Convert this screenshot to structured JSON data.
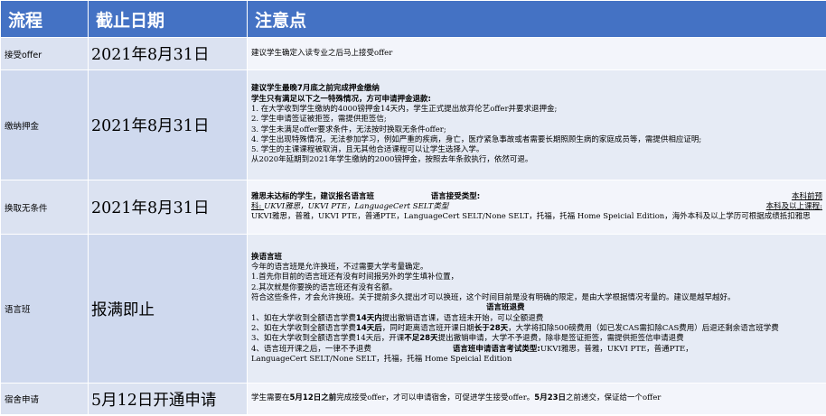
{
  "header": {
    "col1": "流程",
    "col2": "截止日期",
    "col3": "注意点"
  },
  "rows": [
    {
      "step": "接受offer",
      "deadline": "2021年8月31日",
      "notes": {
        "l1": "建议学生确定入读专业之后马上接受offer"
      }
    },
    {
      "step": "缴纳押金",
      "deadline": "2021年8月31日",
      "notes": {
        "t1": "建议学生最晚7月底之前完成押金缴纳",
        "t2": "学生只有满足以下之一特殊情况，方可申请押金退款:",
        "l1": "1. 在大学收到学生缴纳的4000镑押金14天内，学生正式提出放弃伦艺offer并要求退押金;",
        "l2": "2. 学生申请签证被拒签，需提供拒签信;",
        "l3": "3. 学生未满足offer要求条件，无法按时换取无条件offer;",
        "l4": "4. 学生出现特殊情况，无法参加学习，例如严重的疾病，身亡，医疗紧急事故或者需要长期照顾生病的家庭成员等，需提供相应证明;",
        "l5": "5. 学生的主课课程被取消，且无其他合适课程可以让学生选择入学。",
        "l6": "从2020年延期到2021年学生缴纳的2000镑押金，按照去年条款执行，依然可退。"
      }
    },
    {
      "step": "换取无条件",
      "deadline": "2021年8月31日",
      "notes": {
        "t1": "雅思未达标的学生，建议报名语言班",
        "t2": "语言接受类型:",
        "t3": "本科前预",
        "l1a": "科: ",
        "l1b": "UKVI雅思，UKVI PTE，LanguageCert SELT类型",
        "l1c": "本科及以上课程:",
        "l2": "UKVI雅思，普雅，UKVI PTE，普通PTE，LanguageCert SELT/None SELT，托福，托福 Home Speicial Edition，海外本科及以上学历可根据成绩抵扣雅思"
      }
    },
    {
      "step": "语言班",
      "deadline": "报满即止",
      "notes": {
        "t1": "换语言班",
        "l1": "今年的语言班是允许换班，不过需要大学考量确定。",
        "l2": "1.首先你目前的语言班还有没有时间报另外的学生填补位置，",
        "l3": "2.其次就是你要换的语言班还有没有名额。",
        "l4": "符合这些条件，才会允许换班。关于提前多久提出才可以换班，这个时间目前是没有明确的限定，是由大学根据情况考量的。建议是越早越好。",
        "t2": "语言班退费",
        "l5a": "1、如在大学收到全额语言学费",
        "l5b": "14天内",
        "l5c": "提出撤销语言课，语言班未开始，可以全额退费",
        "l6a": "2、如在大学收到全额语言学费",
        "l6b": "14天后",
        "l6c": "，同时距离语言班开课日期",
        "l6d": "长于28天",
        "l6e": "，大学将扣除500磅费用（如已发CAS需扣除CAS费用）后退还剩余语言班学费",
        "l7a": "3、如在大学收到全额语言学费14天后，开课",
        "l7b": "不足28天",
        "l7c": "提出撤销申请，大学不予退费，除非是签证拒签，需提供拒签信申请退费",
        "l8a": "4、语言班开课之后，一律不予退费",
        "l8b": "语言班申请语言考试类型:",
        "l8c": "UKVI雅思，普雅，UKVI PTE，普通PTE，",
        "l9": "LanguageCert SELT/None SELT，托福，托福 Home Speicial Edition"
      }
    },
    {
      "step": "宿舍申请",
      "deadline": "5月12日开通申请",
      "notes": {
        "l1a": "学生需要在",
        "l1b": "5月12日之前",
        "l1c": "完成接受offer，才可以申请宿舍，可促进学生接受offer。",
        "l1d": "5月23日",
        "l1e": "之前递交，保证给一个offer"
      }
    }
  ]
}
